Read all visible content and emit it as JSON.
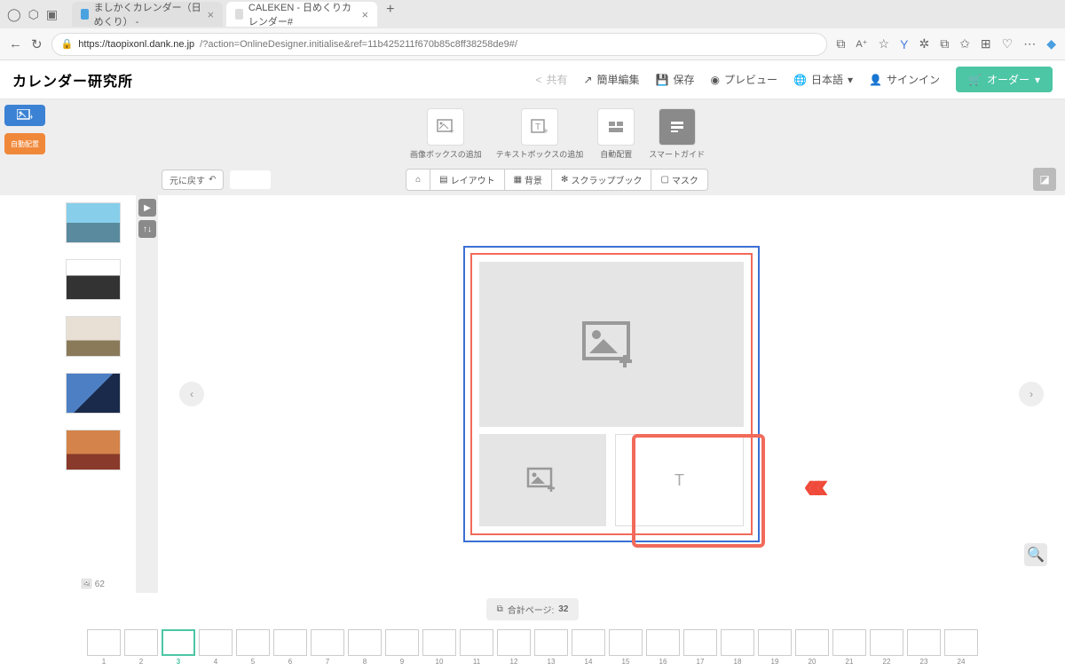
{
  "browser": {
    "tabs": [
      {
        "title": "ましかくカレンダー（日めくり） -",
        "active": false
      },
      {
        "title": "CALEKEN - 日めくりカレンダー#",
        "active": true
      }
    ],
    "url_host": "https://taopixonl.dank.ne.jp",
    "url_path": "/?action=OnlineDesigner.initialise&ref=11b425211f670b85c8ff38258de9#/"
  },
  "header": {
    "logo": "カレンダー研究所",
    "share": "共有",
    "easy_edit": "簡単編集",
    "save": "保存",
    "preview": "プレビュー",
    "language": "日本語",
    "signin": "サインイン",
    "order": "オーダー"
  },
  "toolbar": {
    "add_image": "画像ボックスの追加",
    "add_text": "テキストボックスの追加",
    "auto_arrange": "自動配置",
    "smart_guide": "スマートガイド"
  },
  "secbar": {
    "undo": "元に戻す",
    "layout": "レイアウト",
    "background": "背景",
    "scrapbook": "スクラップブック",
    "mask": "マスク"
  },
  "sidebar": {
    "auto_layout": "自動配置",
    "image_count": "62"
  },
  "canvas": {
    "text_placeholder": "T"
  },
  "footer": {
    "page_total_label": "合計ページ:",
    "page_total": "32",
    "pages": [
      1,
      2,
      3,
      4,
      5,
      6,
      7,
      8,
      9,
      10,
      11,
      12,
      13,
      14,
      15,
      16,
      17,
      18,
      19,
      20,
      21,
      22,
      23,
      24
    ],
    "active_page": 3
  }
}
